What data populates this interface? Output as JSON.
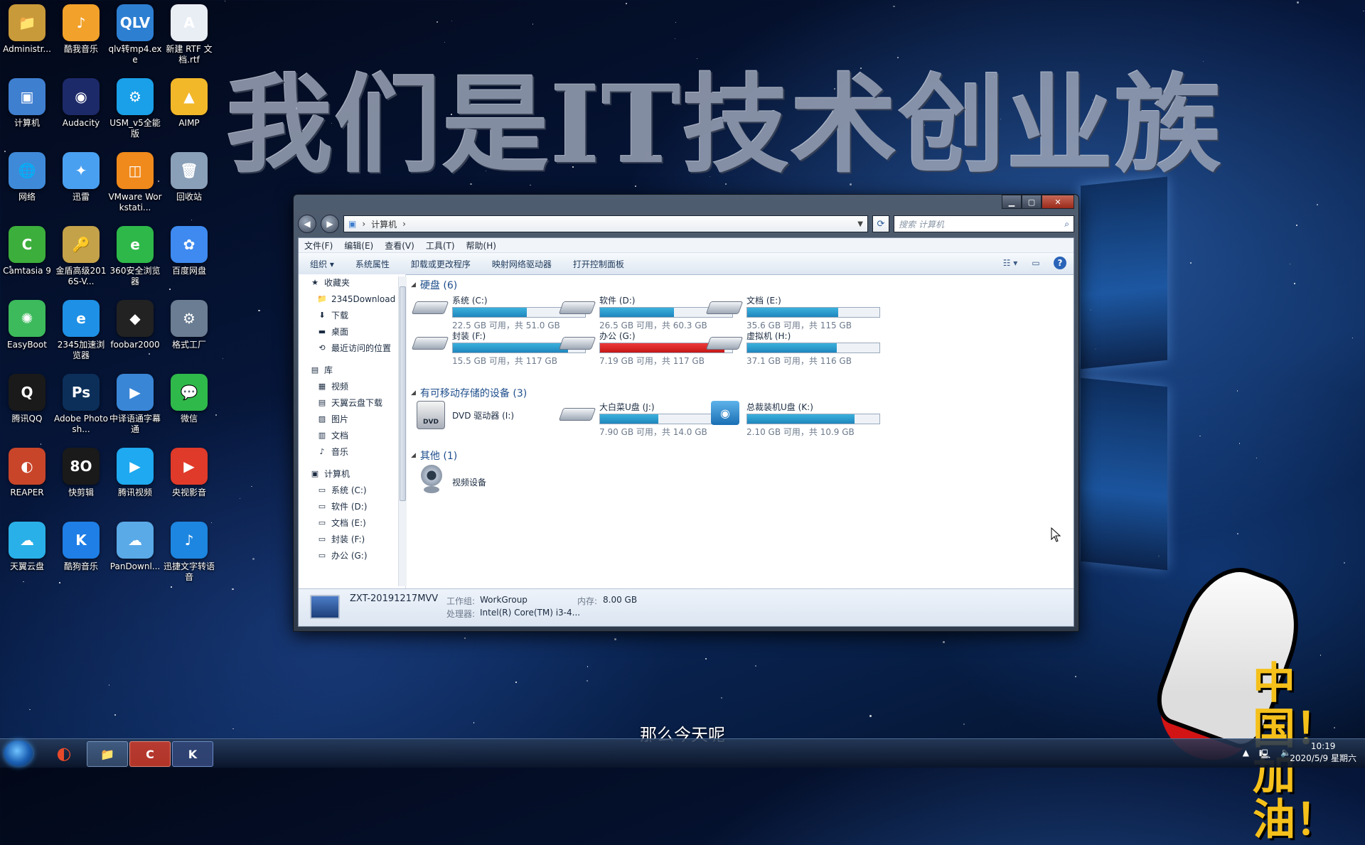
{
  "banner": "我们是IT技术创业族",
  "desktop_icons": [
    {
      "label": "Administr...",
      "glyph": "📁",
      "color": "#c99a3a"
    },
    {
      "label": "酷我音乐",
      "glyph": "♪",
      "color": "#f2a12a"
    },
    {
      "label": "qlv转mp4.exe",
      "glyph": "QLV",
      "color": "#2d7fd2"
    },
    {
      "label": "新建 RTF 文档.rtf",
      "glyph": "A",
      "color": "#e9eef5"
    },
    {
      "label": "计算机",
      "glyph": "▣",
      "color": "#3f7fd0"
    },
    {
      "label": "Audacity",
      "glyph": "◉",
      "color": "#1d2a6a"
    },
    {
      "label": "USM_v5全能版",
      "glyph": "⚙",
      "color": "#1aa0e8"
    },
    {
      "label": "AIMP",
      "glyph": "▲",
      "color": "#f2b82a"
    },
    {
      "label": "网络",
      "glyph": "🌐",
      "color": "#3f8ad8"
    },
    {
      "label": "迅雷",
      "glyph": "✦",
      "color": "#4aa0f0"
    },
    {
      "label": "VMware Workstati...",
      "glyph": "◫",
      "color": "#f08a1c"
    },
    {
      "label": "回收站",
      "glyph": "🗑",
      "color": "#8aa0b8"
    },
    {
      "label": "Camtasia 9",
      "glyph": "C",
      "color": "#3cae3c"
    },
    {
      "label": "金盾高级2016S-V...",
      "glyph": "🔑",
      "color": "#c4a24a"
    },
    {
      "label": "360安全浏览器",
      "glyph": "e",
      "color": "#2eb84a"
    },
    {
      "label": "百度网盘",
      "glyph": "✿",
      "color": "#3e8af0"
    },
    {
      "label": "EasyBoot",
      "glyph": "✺",
      "color": "#3cba5c"
    },
    {
      "label": "2345加速浏览器",
      "glyph": "e",
      "color": "#1e90e6"
    },
    {
      "label": "foobar2000",
      "glyph": "◆",
      "color": "#222"
    },
    {
      "label": "格式工厂",
      "glyph": "⚙",
      "color": "#6a7d92"
    },
    {
      "label": "腾讯QQ",
      "glyph": "Q",
      "color": "#1a1a1a"
    },
    {
      "label": "Adobe Photosh...",
      "glyph": "Ps",
      "color": "#0c2f5a"
    },
    {
      "label": "中译语通字幕通",
      "glyph": "▶",
      "color": "#3a86d6"
    },
    {
      "label": "微信",
      "glyph": "💬",
      "color": "#2fb94a"
    },
    {
      "label": "REAPER",
      "glyph": "◐",
      "color": "#c9452a"
    },
    {
      "label": "快剪辑",
      "glyph": "8O",
      "color": "#1a1a1a"
    },
    {
      "label": "腾讯视频",
      "glyph": "▶",
      "color": "#1ea9f0"
    },
    {
      "label": "央视影音",
      "glyph": "▶",
      "color": "#e03a2a"
    },
    {
      "label": "天翼云盘",
      "glyph": "☁",
      "color": "#2ab0e8"
    },
    {
      "label": "酷狗音乐",
      "glyph": "K",
      "color": "#1f7fe6"
    },
    {
      "label": "PanDownl...",
      "glyph": "☁",
      "color": "#5aaae8"
    },
    {
      "label": "迅捷文字转语音",
      "glyph": "♪",
      "color": "#1d86e0"
    }
  ],
  "window": {
    "address": "计算机",
    "search_placeholder": "搜索 计算机",
    "menu": [
      "文件(F)",
      "编辑(E)",
      "查看(V)",
      "工具(T)",
      "帮助(H)"
    ],
    "commands": [
      "组织 ▾",
      "系统属性",
      "卸载或更改程序",
      "映射网络驱动器",
      "打开控制面板"
    ],
    "nav": {
      "favorites": "收藏夹",
      "favorites_items": [
        "2345Download",
        "下载",
        "桌面",
        "最近访问的位置"
      ],
      "libraries": "库",
      "libraries_items": [
        "视频",
        "天翼云盘下载",
        "图片",
        "文档",
        "音乐"
      ],
      "computer": "计算机",
      "computer_items": [
        "系统 (C:)",
        "软件 (D:)",
        "文档 (E:)",
        "封装 (F:)",
        "办公 (G:)"
      ]
    },
    "groups": {
      "hard_disks": "硬盘 (6)",
      "removable": "有可移动存储的设备 (3)",
      "other": "其他 (1)"
    },
    "drives": [
      {
        "name": "系统 (C:)",
        "free": "22.5 GB 可用，共 51.0 GB",
        "used_pct": 56,
        "red": false
      },
      {
        "name": "软件 (D:)",
        "free": "26.5 GB 可用，共 60.3 GB",
        "used_pct": 56,
        "red": false
      },
      {
        "name": "文档 (E:)",
        "free": "35.6 GB 可用，共 115 GB",
        "used_pct": 69,
        "red": false
      },
      {
        "name": "封装 (F:)",
        "free": "15.5 GB 可用，共 117 GB",
        "used_pct": 87,
        "red": false
      },
      {
        "name": "办公 (G:)",
        "free": "7.19 GB 可用，共 117 GB",
        "used_pct": 94,
        "red": true
      },
      {
        "name": "虚拟机 (H:)",
        "free": "37.1 GB 可用，共 116 GB",
        "used_pct": 68,
        "red": false
      }
    ],
    "removable": [
      {
        "name": "DVD 驱动器 (I:)"
      },
      {
        "name": "大白菜U盘 (J:)",
        "free": "7.90 GB 可用，共 14.0 GB",
        "used_pct": 44
      },
      {
        "name": "总裁装机U盘 (K:)",
        "free": "2.10 GB 可用，共 10.9 GB",
        "used_pct": 81
      }
    ],
    "other_item": "视频设备",
    "status": {
      "computer_name": "ZXT-20191217MVV",
      "workgroup_label": "工作组:",
      "workgroup": "WorkGroup",
      "memory_label": "内存:",
      "memory": "8.00 GB",
      "cpu_label": "处理器:",
      "cpu": "Intel(R) Core(TM) i3-4..."
    }
  },
  "subtitle": "那么今天呢",
  "poster_text": "中国！\n加油！",
  "taskbar": {
    "time": "10:19",
    "date": "2020/5/9 星期六"
  },
  "colors": {
    "accent_bar": "#1f86bd",
    "critical_bar": "#c41717"
  }
}
